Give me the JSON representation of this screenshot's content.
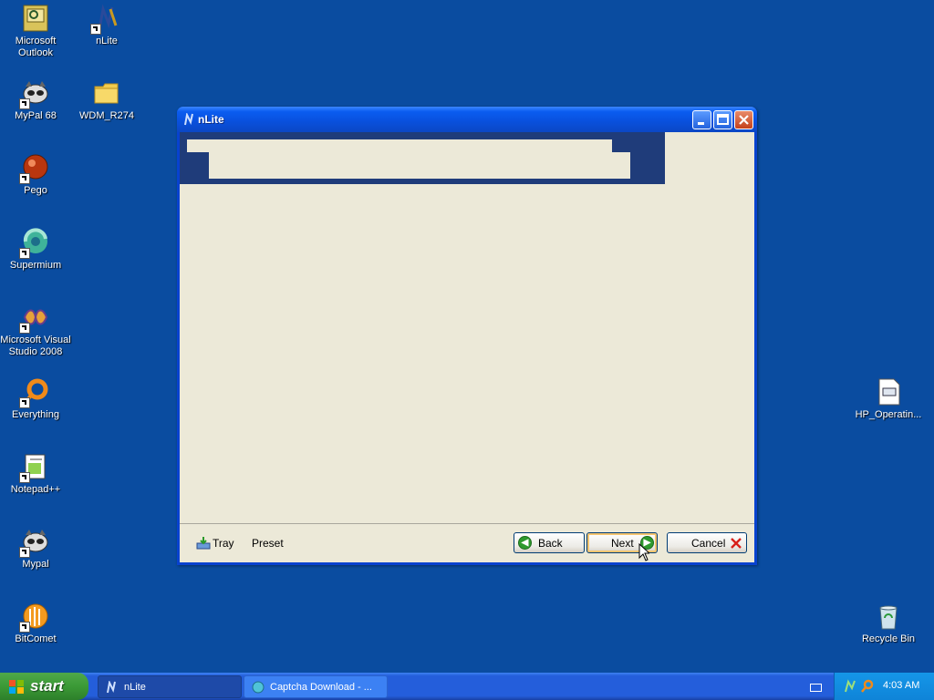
{
  "desktop": {
    "icons": [
      {
        "label": "Microsoft Outlook",
        "icon": "outlook-icon"
      },
      {
        "label": "nLite",
        "icon": "nlite-icon"
      },
      {
        "label": "MyPal 68",
        "icon": "mypal-icon"
      },
      {
        "label": "WDM_R274",
        "icon": "folder-icon"
      },
      {
        "label": "Pego",
        "icon": "pego-icon"
      },
      {
        "label": "Supermium",
        "icon": "supermium-icon"
      },
      {
        "label": "Microsoft Visual Studio 2008",
        "icon": "visual-studio-icon"
      },
      {
        "label": "Everything",
        "icon": "everything-icon"
      },
      {
        "label": "Notepad++",
        "icon": "notepadpp-icon"
      },
      {
        "label": "Mypal",
        "icon": "mypal-icon"
      },
      {
        "label": "BitComet",
        "icon": "bitcomet-icon"
      },
      {
        "label": "HP_Operatin...",
        "icon": "document-icon"
      },
      {
        "label": "Recycle Bin",
        "icon": "recycle-bin-icon"
      }
    ]
  },
  "window": {
    "title": "nLite",
    "bottom": {
      "tray_label": "Tray",
      "preset_label": "Preset",
      "back_label": "Back",
      "next_label": "Next",
      "cancel_label": "Cancel"
    }
  },
  "taskbar": {
    "start_label": "start",
    "items": [
      {
        "label": "nLite",
        "active": true
      },
      {
        "label": "Captcha Download - ...",
        "active": false
      }
    ],
    "clock": "4:03 AM"
  }
}
